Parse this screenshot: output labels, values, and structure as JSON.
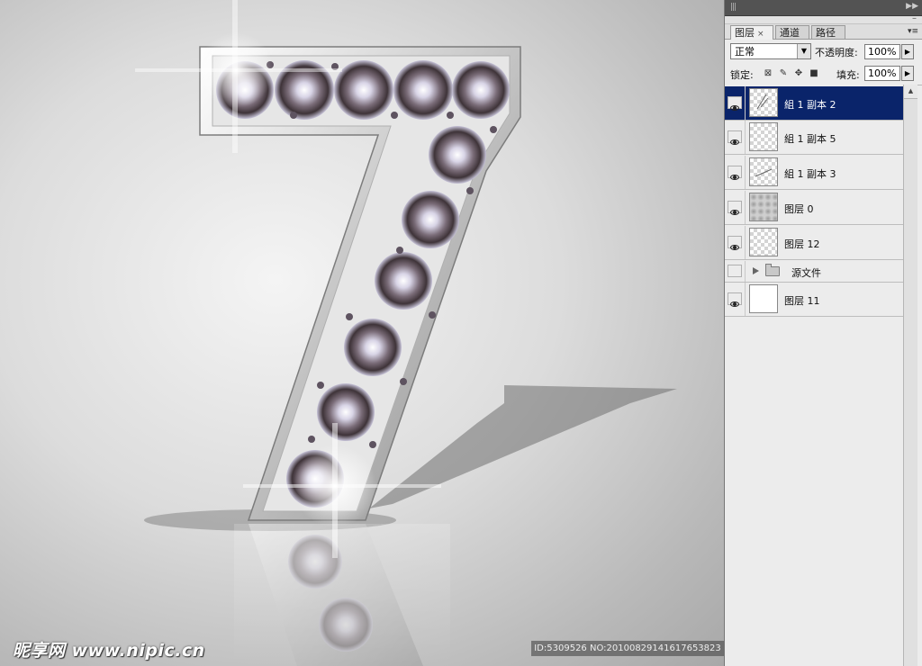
{
  "canvas": {
    "watermark_left": "昵享网 www.nipic.cn",
    "watermark_right": "ID:5309526 NO:20100829141617653823"
  },
  "layers_panel": {
    "tabs": [
      {
        "label": "图层",
        "active": true
      },
      {
        "label": "通道",
        "active": false
      },
      {
        "label": "路径",
        "active": false
      }
    ],
    "tab_close_glyph": "×",
    "blend_mode": "正常",
    "opacity_label": "不透明度:",
    "opacity_value": "100%",
    "lock_label": "锁定:",
    "fill_label": "填充:",
    "fill_value": "100%",
    "layers": [
      {
        "name": "組 1 副本 2",
        "visible": true,
        "selected": true,
        "thumb": "transparent-sketch"
      },
      {
        "name": "組 1 副本 5",
        "visible": true,
        "selected": false,
        "thumb": "transparent"
      },
      {
        "name": "組 1 副本 3",
        "visible": true,
        "selected": false,
        "thumb": "transparent-sketch"
      },
      {
        "name": "图层 0",
        "visible": true,
        "selected": false,
        "thumb": "gray-gradient"
      },
      {
        "name": "图层 12",
        "visible": true,
        "selected": false,
        "thumb": "transparent"
      },
      {
        "name": "源文件",
        "visible": false,
        "selected": false,
        "type": "group"
      },
      {
        "name": "图层 11",
        "visible": true,
        "selected": false,
        "thumb": "white"
      }
    ]
  },
  "icons": [
    "eye-icon",
    "folder-icon",
    "expand-triangle-icon",
    "lock-transparent-icon",
    "lock-brush-icon",
    "lock-move-icon",
    "lock-all-icon",
    "dropdown-arrow-icon",
    "panel-menu-icon"
  ]
}
